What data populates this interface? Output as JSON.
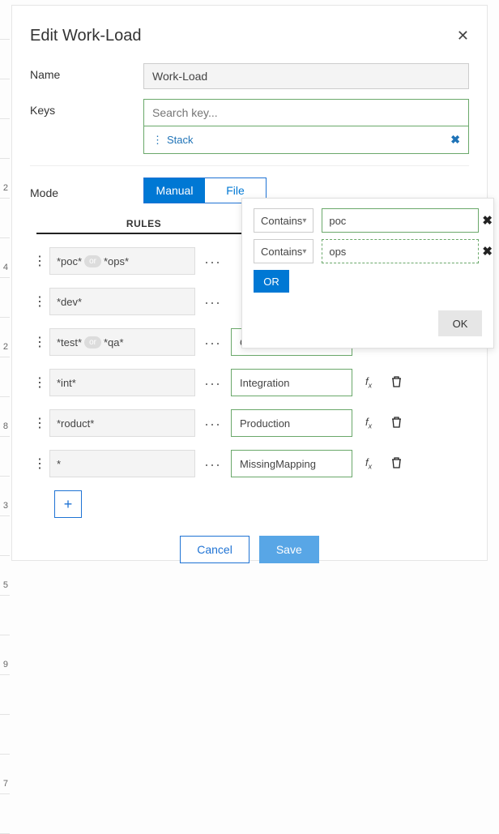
{
  "title": "Edit Work-Load",
  "fields": {
    "name_label": "Name",
    "name_value": "Work-Load",
    "keys_label": "Keys",
    "keys_placeholder": "Search key...",
    "key_chip": "Stack",
    "mode_label": "Mode",
    "mode_manual": "Manual",
    "mode_file": "File"
  },
  "rules_header": "RULES",
  "rules": [
    {
      "pattern_before": "*poc*",
      "or": "or",
      "pattern_after": "*ops*",
      "mapping": ""
    },
    {
      "pattern_before": "*dev*",
      "or": "",
      "pattern_after": "",
      "mapping": ""
    },
    {
      "pattern_before": "*test*",
      "or": "or",
      "pattern_after": "*qa*",
      "mapping": "QA"
    },
    {
      "pattern_before": "*int*",
      "or": "",
      "pattern_after": "",
      "mapping": "Integration"
    },
    {
      "pattern_before": "*roduct*",
      "or": "",
      "pattern_after": "",
      "mapping": "Production"
    },
    {
      "pattern_before": "*",
      "or": "",
      "pattern_after": "",
      "mapping": "MissingMapping"
    }
  ],
  "dots": "...",
  "fx_label": "f",
  "fx_sub": "x",
  "add_plus": "+",
  "footer": {
    "cancel": "Cancel",
    "save": "Save"
  },
  "popover": {
    "select1": "Contains",
    "value1": "poc",
    "select2": "Contains",
    "value2": "ops",
    "or_btn": "OR",
    "ok_btn": "OK"
  },
  "bg_numbers": [
    "",
    "",
    "",
    "",
    "2",
    "",
    "4",
    "",
    "2",
    "",
    "8",
    "",
    "3",
    "",
    "5",
    "",
    "9",
    "",
    "",
    "7",
    ""
  ]
}
